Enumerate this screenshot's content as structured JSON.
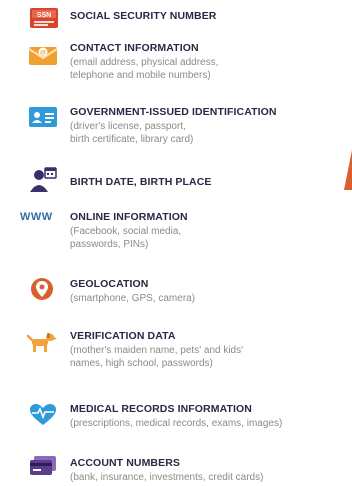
{
  "items": [
    {
      "title": "SOCIAL SECURITY NUMBER",
      "icon": "ssn-card-icon",
      "icon_text": "SSN"
    },
    {
      "title": "CONTACT INFORMATION",
      "icon": "envelope-icon",
      "desc": [
        "(email address, physical address,",
        "telephone and mobile numbers)"
      ]
    },
    {
      "title": "GOVERNMENT-ISSUED IDENTIFICATION",
      "icon": "id-card-icon",
      "desc": [
        "(driver's license, passport,",
        "birth certificate, library card)"
      ]
    },
    {
      "title": "BIRTH DATE, BIRTH PLACE",
      "icon": "person-calendar-icon"
    },
    {
      "title": "ONLINE INFORMATION",
      "icon": "www-icon",
      "icon_text": "WWW",
      "desc": [
        "(Facebook, social media,",
        "passwords, PINs)"
      ]
    },
    {
      "title": "GEOLOCATION",
      "icon": "location-pin-icon",
      "desc": [
        "(smartphone, GPS, camera)"
      ]
    },
    {
      "title": "VERIFICATION DATA",
      "icon": "dog-icon",
      "desc": [
        "(mother's maiden name, pets' and kids'",
        "names, high school, passwords)"
      ]
    },
    {
      "title": "MEDICAL RECORDS INFORMATION",
      "icon": "heart-pulse-icon",
      "desc": [
        "(prescriptions, medical records, exams, images)"
      ]
    },
    {
      "title": "ACCOUNT NUMBERS",
      "icon": "credit-card-icon",
      "desc": [
        "(bank, insurance, investments, credit cards)"
      ]
    }
  ],
  "colors": {
    "title": "#2b2744",
    "desc": "#8a8a8a",
    "ssn_red": "#d9452b",
    "envelope_orange": "#f0a030",
    "id_blue": "#2e9ad8",
    "person_navy": "#3b2f6b",
    "www_blue": "#2f6fa8",
    "pin_orange": "#d9602e",
    "dog_orange": "#f2a23a",
    "heart_blue": "#2e9ad8",
    "card_purple": "#5a3d8c"
  }
}
